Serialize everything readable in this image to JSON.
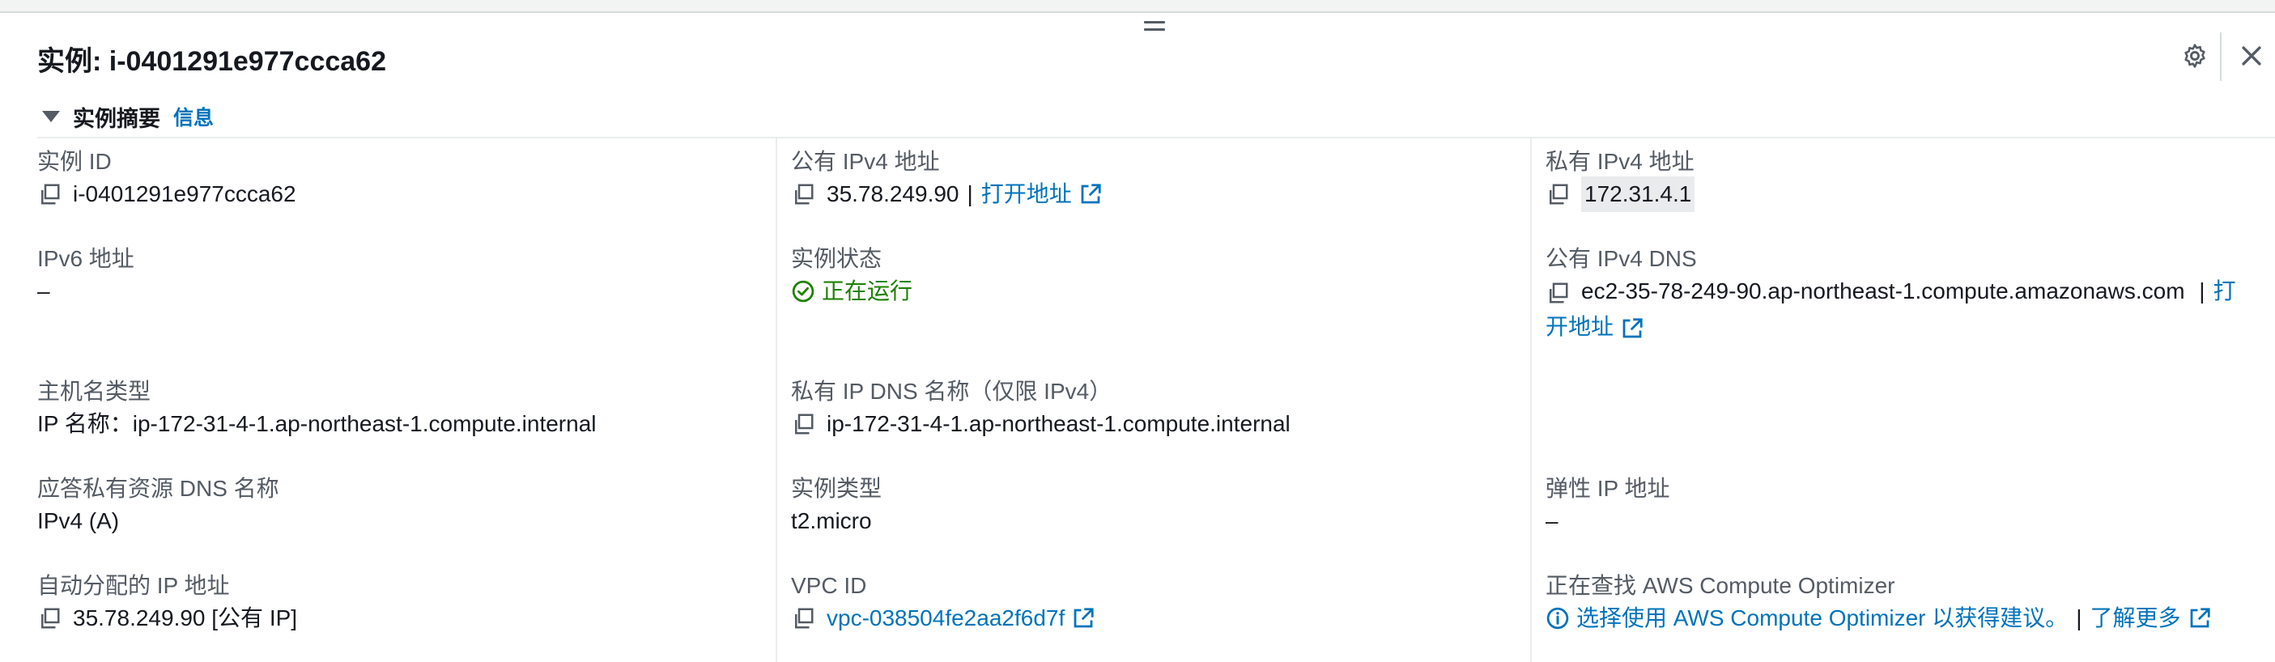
{
  "header": {
    "title": "实例: i-0401291e977ccca62"
  },
  "summary": {
    "label": "实例摘要",
    "info_link": "信息"
  },
  "fields": {
    "instance_id": {
      "label": "实例 ID",
      "value": "i-0401291e977ccca62"
    },
    "public_ipv4": {
      "label": "公有 IPv4 地址",
      "value": "35.78.249.90",
      "sep": "|",
      "link": "打开地址"
    },
    "private_ipv4": {
      "label": "私有 IPv4 地址",
      "value": "172.31.4.1"
    },
    "ipv6": {
      "label": "IPv6 地址",
      "value": "–"
    },
    "instance_state": {
      "label": "实例状态",
      "value": "正在运行"
    },
    "public_dns": {
      "label": "公有 IPv4 DNS",
      "value": "ec2-35-78-249-90.ap-northeast-1.compute.amazonaws.com",
      "sep": "|",
      "link": "打开地址"
    },
    "hostname_type": {
      "label": "主机名类型",
      "value": "IP 名称：ip-172-31-4-1.ap-northeast-1.compute.internal"
    },
    "private_dns": {
      "label": "私有 IP DNS 名称（仅限 IPv4）",
      "value": "ip-172-31-4-1.ap-northeast-1.compute.internal"
    },
    "resource_dns": {
      "label": "应答私有资源 DNS 名称",
      "value": "IPv4 (A)"
    },
    "instance_type": {
      "label": "实例类型",
      "value": "t2.micro"
    },
    "elastic_ip": {
      "label": "弹性 IP 地址",
      "value": "–"
    },
    "auto_ip": {
      "label": "自动分配的 IP 地址",
      "value": "35.78.249.90 [公有 IP]"
    },
    "vpc_id": {
      "label": "VPC ID",
      "value": "vpc-038504fe2aa2f6d7f"
    },
    "optimizer": {
      "label": "正在查找 AWS Compute Optimizer",
      "value": "选择使用 AWS Compute Optimizer 以获得建议。",
      "sep": "|",
      "link": "了解更多"
    }
  },
  "colors": {
    "link": "#0073bb",
    "success": "#1d8102",
    "label": "#545b64",
    "text": "#16191f"
  },
  "icons": {
    "copy": "copy-icon",
    "external": "external-link-icon",
    "gear": "gear-icon",
    "close": "close-icon",
    "caret": "caret-down-icon",
    "status": "check-circle-icon",
    "info": "info-circle-icon"
  }
}
